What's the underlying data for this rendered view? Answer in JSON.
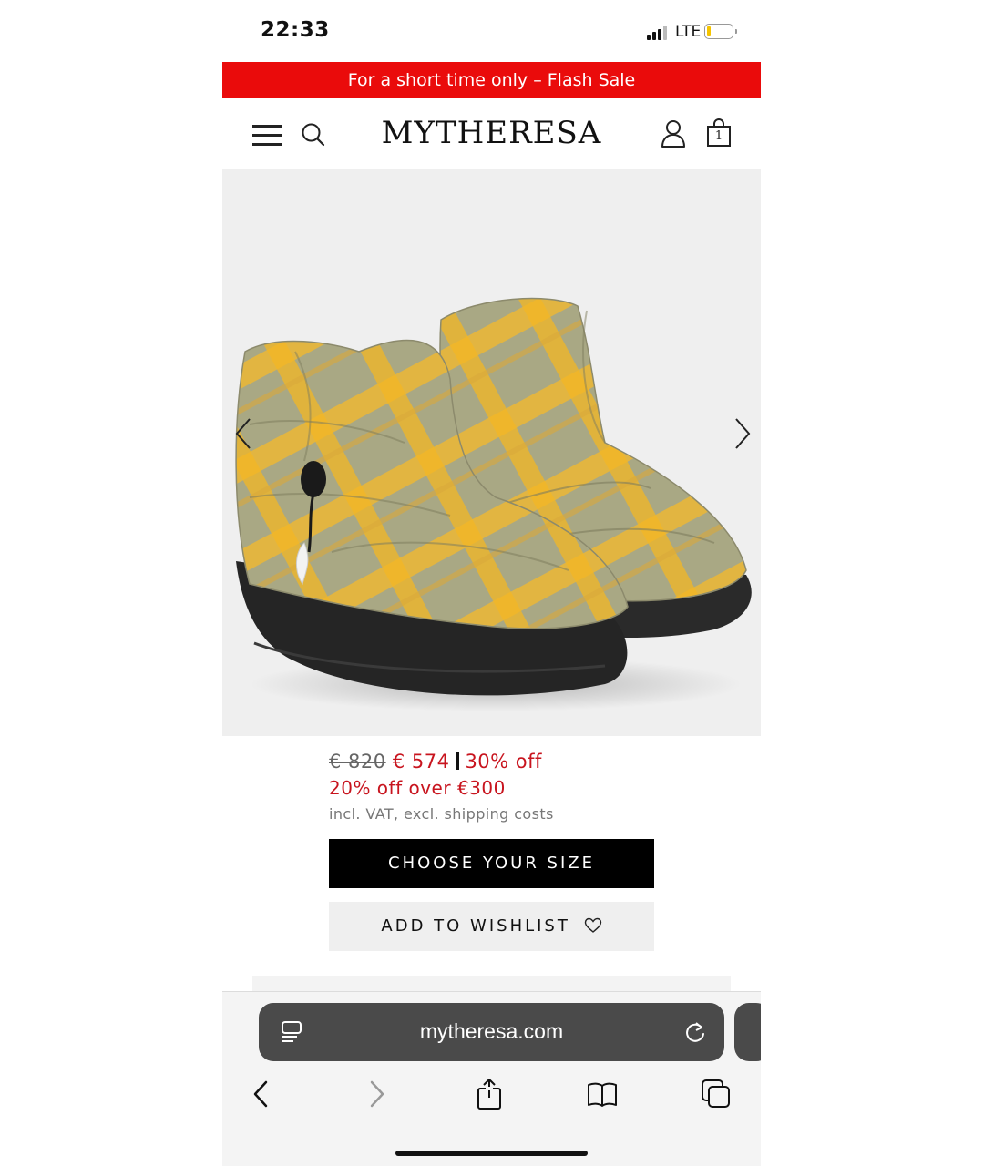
{
  "status_bar": {
    "time": "22:33",
    "network": "LTE"
  },
  "banner": {
    "text": "For a short time only – Flash Sale"
  },
  "header": {
    "logo": "MYTHERESA",
    "cart_count": "1"
  },
  "product": {
    "old_price": "€ 820",
    "price": "€ 574",
    "discount": "30% off",
    "promo": "20% off over €300",
    "vat_note": "incl. VAT, excl. shipping costs",
    "choose_size_label": "CHOOSE YOUR SIZE",
    "wishlist_label": "ADD TO WISHLIST"
  },
  "browser": {
    "url": "mytheresa.com"
  },
  "colors": {
    "banner": "#ea0b0b",
    "price_red": "#c8141e",
    "button_black": "#000000"
  },
  "icons": [
    "menu-icon",
    "search-icon",
    "user-icon",
    "bag-icon",
    "chevron-left-icon",
    "chevron-right-icon",
    "heart-icon",
    "reader-icon",
    "reload-icon",
    "back-icon",
    "forward-icon",
    "share-icon",
    "bookmarks-icon",
    "tabs-icon"
  ]
}
